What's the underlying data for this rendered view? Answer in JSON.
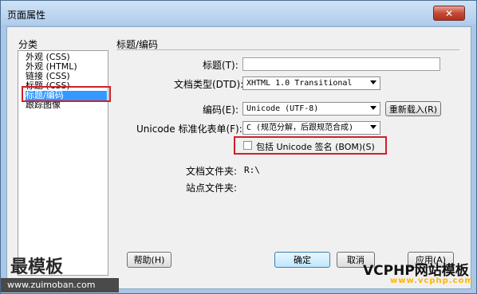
{
  "window": {
    "title": "页面属性",
    "close_symbol": "✕"
  },
  "categories": {
    "header": "分类",
    "items": [
      {
        "label": "外观 (CSS)",
        "selected": false
      },
      {
        "label": "外观 (HTML)",
        "selected": false
      },
      {
        "label": "链接 (CSS)",
        "selected": false
      },
      {
        "label": "标题 (CSS)",
        "selected": false
      },
      {
        "label": "标题/编码",
        "selected": true
      },
      {
        "label": "跟踪图像",
        "selected": false
      }
    ]
  },
  "panel": {
    "section_title": "标题/编码",
    "title_label": "标题(T):",
    "title_value": "",
    "doctype_label": "文档类型(DTD):",
    "doctype_value": "XHTML 1.0 Transitional",
    "encoding_label": "编码(E):",
    "encoding_value": "Unicode (UTF-8)",
    "reload_button": "重新载入(R)",
    "normalization_label": "Unicode 标准化表单(F):",
    "normalization_value": "C (规范分解，后跟规范合成)",
    "bom_checkbox_label": "包括 Unicode 签名 (BOM)(S)",
    "bom_checked": false,
    "document_folder_label": "文档文件夹:",
    "document_folder_value": "R:\\",
    "site_folder_label": "站点文件夹:",
    "site_folder_value": ""
  },
  "buttons": {
    "help": "帮助(H)",
    "ok": "确定",
    "cancel": "取消",
    "apply": "应用(A)"
  },
  "watermarks": {
    "left_text": "最模板",
    "left_url": "www.zuimoban.com",
    "right_text": "VCPHP网站模板",
    "right_url": "www.vcphp.com"
  },
  "colors": {
    "highlight": "#d0202a",
    "selection": "#3399ff",
    "titlebar": "#b0cdeb"
  }
}
